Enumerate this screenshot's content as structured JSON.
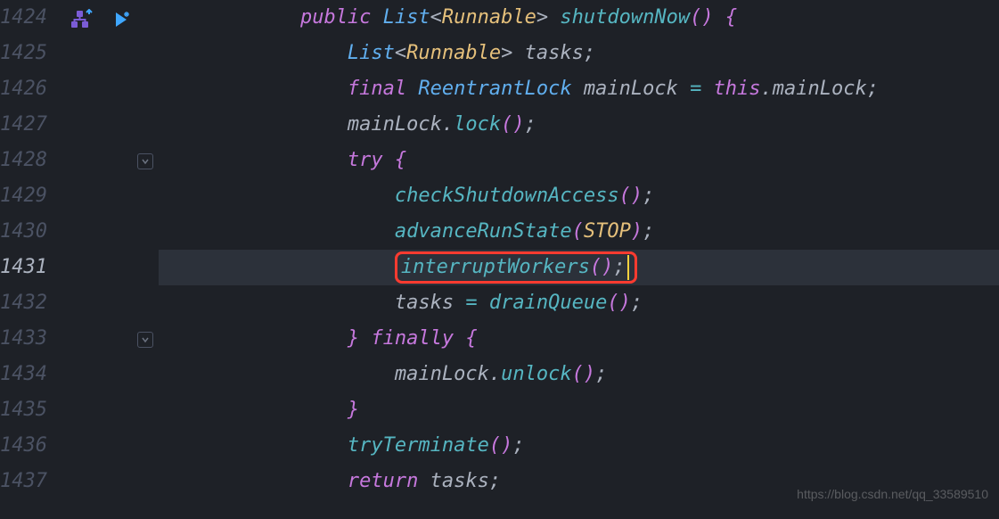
{
  "lineStart": 1424,
  "currentLine": 1431,
  "icons": {
    "hierarchy": "hierarchy-icon",
    "run": "run-icon"
  },
  "code": {
    "l1424": {
      "indent": "            ",
      "t": [
        [
          "kw",
          "public"
        ],
        [
          "punc",
          " "
        ],
        [
          "type",
          "List"
        ],
        [
          "punc",
          "<"
        ],
        [
          "gen",
          "Runnable"
        ],
        [
          "punc",
          "> "
        ],
        [
          "fn",
          "shutdownNow"
        ],
        [
          "brace",
          "()"
        ],
        [
          "punc",
          " "
        ],
        [
          "brace",
          "{"
        ]
      ]
    },
    "l1425": {
      "indent": "                ",
      "t": [
        [
          "type",
          "List"
        ],
        [
          "punc",
          "<"
        ],
        [
          "gen",
          "Runnable"
        ],
        [
          "punc",
          "> "
        ],
        [
          "ident",
          "tasks"
        ],
        [
          "punc",
          ";"
        ]
      ]
    },
    "l1426": {
      "indent": "                ",
      "t": [
        [
          "kw",
          "final"
        ],
        [
          "punc",
          " "
        ],
        [
          "type",
          "ReentrantLock"
        ],
        [
          "punc",
          " "
        ],
        [
          "ident",
          "mainLock"
        ],
        [
          "punc",
          " "
        ],
        [
          "op",
          "="
        ],
        [
          "punc",
          " "
        ],
        [
          "kw",
          "this"
        ],
        [
          "punc",
          "."
        ],
        [
          "ident",
          "mainLock"
        ],
        [
          "punc",
          ";"
        ]
      ]
    },
    "l1427": {
      "indent": "                ",
      "t": [
        [
          "ident",
          "mainLock"
        ],
        [
          "punc",
          "."
        ],
        [
          "fn",
          "lock"
        ],
        [
          "brace",
          "()"
        ],
        [
          "punc",
          ";"
        ]
      ]
    },
    "l1428": {
      "indent": "                ",
      "t": [
        [
          "kw",
          "try"
        ],
        [
          "punc",
          " "
        ],
        [
          "brace",
          "{"
        ]
      ]
    },
    "l1429": {
      "indent": "                    ",
      "t": [
        [
          "fn",
          "checkShutdownAccess"
        ],
        [
          "brace",
          "()"
        ],
        [
          "punc",
          ";"
        ]
      ]
    },
    "l1430": {
      "indent": "                    ",
      "t": [
        [
          "fn",
          "advanceRunState"
        ],
        [
          "brace",
          "("
        ],
        [
          "gen",
          "STOP"
        ],
        [
          "brace",
          ")"
        ],
        [
          "punc",
          ";"
        ]
      ]
    },
    "l1431": {
      "indent": "                    ",
      "boxed": true,
      "t": [
        [
          "fn",
          "interruptWorkers"
        ],
        [
          "brace",
          "()"
        ],
        [
          "punc",
          ";"
        ]
      ]
    },
    "l1432": {
      "indent": "                    ",
      "t": [
        [
          "ident",
          "tasks"
        ],
        [
          "punc",
          " "
        ],
        [
          "op",
          "="
        ],
        [
          "punc",
          " "
        ],
        [
          "fn",
          "drainQueue"
        ],
        [
          "brace",
          "()"
        ],
        [
          "punc",
          ";"
        ]
      ]
    },
    "l1433": {
      "indent": "                ",
      "t": [
        [
          "brace",
          "}"
        ],
        [
          "punc",
          " "
        ],
        [
          "kw",
          "finally"
        ],
        [
          "punc",
          " "
        ],
        [
          "brace",
          "{"
        ]
      ]
    },
    "l1434": {
      "indent": "                    ",
      "t": [
        [
          "ident",
          "mainLock"
        ],
        [
          "punc",
          "."
        ],
        [
          "fn",
          "unlock"
        ],
        [
          "brace",
          "()"
        ],
        [
          "punc",
          ";"
        ]
      ]
    },
    "l1435": {
      "indent": "                ",
      "t": [
        [
          "brace",
          "}"
        ]
      ]
    },
    "l1436": {
      "indent": "                ",
      "t": [
        [
          "fn",
          "tryTerminate"
        ],
        [
          "brace",
          "()"
        ],
        [
          "punc",
          ";"
        ]
      ]
    },
    "l1437": {
      "indent": "                ",
      "t": [
        [
          "kw",
          "return"
        ],
        [
          "punc",
          " "
        ],
        [
          "ident",
          "tasks"
        ],
        [
          "punc",
          ";"
        ]
      ]
    }
  },
  "watermark": "https://blog.csdn.net/qq_33589510"
}
